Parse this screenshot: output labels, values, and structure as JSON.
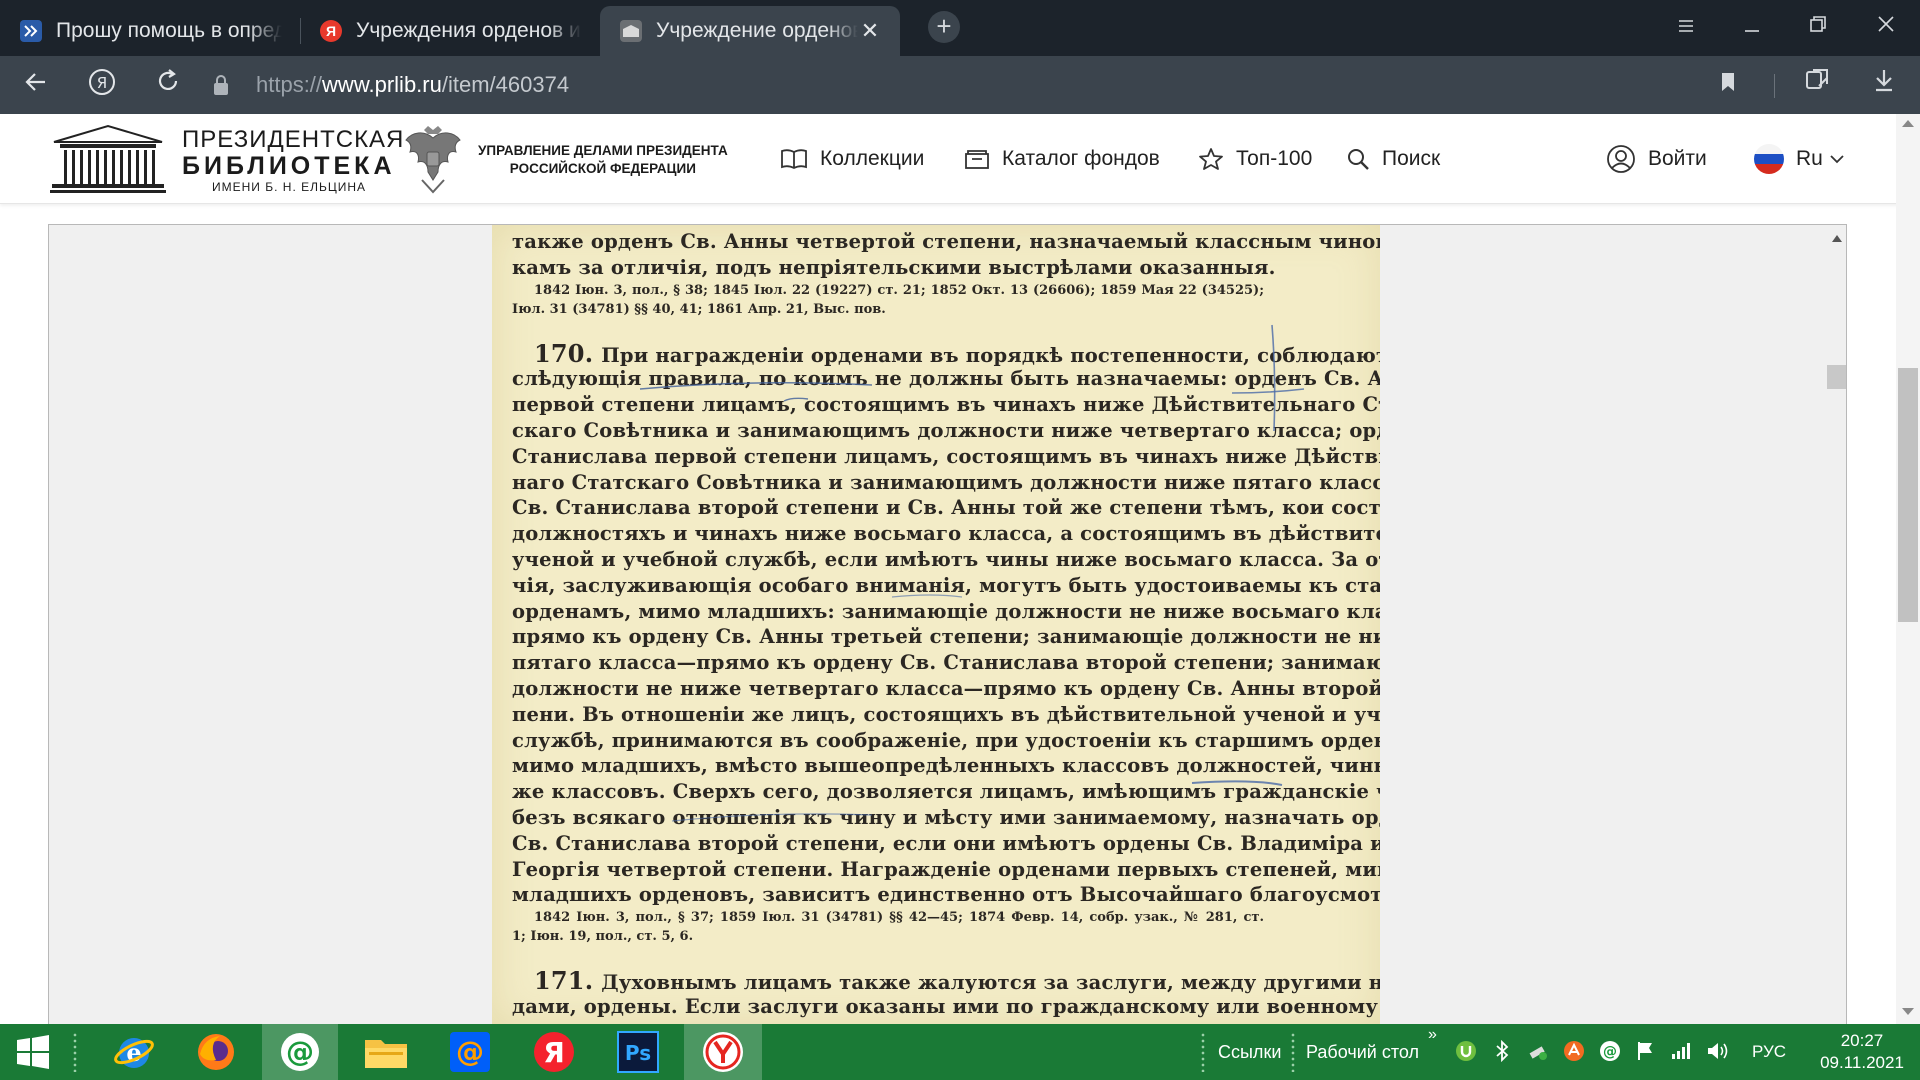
{
  "browser": {
    "tabs": [
      {
        "title": "Прошу помощь в определении",
        "icon": "site-favicon-icon"
      },
      {
        "title": "Учреждения орденов и других",
        "icon": "yandex-favicon-icon"
      },
      {
        "title": "Учреждение орденов и",
        "icon": "library-favicon-icon",
        "active": true
      }
    ],
    "close_tab": "✕",
    "new_tab": "+",
    "url": {
      "proto": "https://",
      "host": "www.prlib.ru",
      "path": "/item/460374"
    },
    "yandex_letter": "Я"
  },
  "site": {
    "logo": {
      "line1": "ПРЕЗИДЕНТСКАЯ",
      "line2": "БИБЛИОТЕКА",
      "line3": "ИМЕНИ Б. Н. ЕЛЬЦИНА"
    },
    "admin": {
      "line1": "УПРАВЛЕНИЕ ДЕЛАМИ ПРЕЗИДЕНТА",
      "line2": "РОССИЙСКОЙ ФЕДЕРАЦИИ"
    },
    "menu": [
      {
        "label": "Коллекции",
        "icon": "book-icon"
      },
      {
        "label": "Каталог фондов",
        "icon": "catalog-folder-icon"
      },
      {
        "label": "Топ-100",
        "icon": "star-icon"
      },
      {
        "label": "Поиск",
        "icon": "search-icon"
      }
    ],
    "login": "Войти",
    "lang": "Ru"
  },
  "scan": {
    "top_lines": [
      "также орденъ Св. Анны четвертой степени, назначаемый классным чинови-",
      "камъ за отличія, подъ непріятельскими выстрѣлами оказанныя."
    ],
    "top_refs": [
      "1842 Іюн. 3, пол., § 38; 1845 Іюл. 22 (19227) ст. 21; 1852 Окт. 13 (26606); 1859 Мая 22 (34525);",
      "Іюл. 31 (34781) §§ 40, 41; 1861 Апр. 21, Выс. пов."
    ],
    "article_170": {
      "number": "170.",
      "first_line": "При награжденіи орденами въ порядкѣ постепенности, соблюдаются",
      "lines": [
        "слѣдующія правила, по коимъ не должны быть назначаемы: орденъ Св. Анны",
        "первой степени лицамъ, состоящимъ въ чинахъ ниже Дѣйствительнаго Стат-",
        "скаго Совѣтника и занимающимъ должности ниже четвертаго класса; орденъ Св.",
        "Станислава первой степени лицамъ, состоящимъ въ чинахъ ниже Дѣйствитель-",
        "наго Статскаго Совѣтника и занимающимъ должности ниже пятаго класса; ордены",
        "Св. Станислава второй степени и Св. Анны той же степени тѣмъ, кои состоятъ въ",
        "должностяхъ и чинахъ ниже восьмаго класса, а состоящимъ въ дѣйствительной",
        "ученой и учебной службѣ, если имѣютъ чины ниже восьмаго класса. За отли-",
        "чія, заслуживающія особаго вниманія, могутъ быть удостоиваемы къ старшимъ",
        "орденамъ, мимо младшихъ: занимающіе должности не ниже восьмаго класса—",
        "прямо къ ордену Св. Анны третьей степени; занимающіе должности не ниже",
        "пятаго класса—прямо къ ордену Св. Станислава второй степени; занимающіе",
        "должности не ниже четвертаго класса—прямо къ ордену Св. Анны второй сте-",
        "пени. Въ отношеніи же лицъ, состоящихъ въ дѣйствительной ученой и учебной",
        "службѣ, принимаются въ соображеніе, при удостоеніи къ старшимъ орденамъ",
        "мимо младшихъ, вмѣсто вышеопредѣленныхъ классовъ должностей, чины тѣхъ",
        "же классовъ. Сверхъ сего, дозволяется лицамъ, имѣющимъ гражданскіе чины,",
        "безъ всякаго отношенія къ чину и мѣсту ими занимаемому, назначать орденъ",
        "Св. Станислава второй степени, если они имѣютъ ордены Св. Владиміра или Св.",
        "Георгія четвертой степени. Награжденіе орденами первыхъ степеней, мимо",
        "младшихъ орденовъ, зависитъ единственно отъ Высочайшаго благоусмотрѣнія."
      ],
      "refs": [
        "1842 Іюн. 3, пол., § 37; 1859 Іюл. 31 (34781) §§ 42—45; 1874 Февр. 14, собр. узак., № 281, ст.",
        "1; Іюн. 19, пол., ст. 5, 6."
      ]
    },
    "article_171": {
      "number": "171.",
      "first_line": "Духовнымъ лицамъ также жалуются за заслуги, между другими награ-",
      "lines": [
        "дами, ордены. Если заслуги оказаны ими по гражданскому или военному вѣдом-"
      ]
    }
  },
  "taskbar": {
    "apps": [
      "windows-start-icon",
      "internet-explorer-icon",
      "firefox-icon",
      "mail-agent-icon",
      "file-explorer-icon",
      "mail-ru-icon",
      "yandex-icon",
      "photoshop-icon",
      "yandex-browser-icon"
    ],
    "links_label": "Ссылки",
    "desktop_label": "Рабочий стол",
    "chevron": "»",
    "lang": "РУС",
    "time": "20:27",
    "date": "09.11.2021"
  },
  "colors": {
    "tabbar": "#1c232b",
    "addrbar": "#3b444d",
    "taskbar": "#1a7a36",
    "paper": "#f3ecc7",
    "ink": "#2b2722"
  }
}
